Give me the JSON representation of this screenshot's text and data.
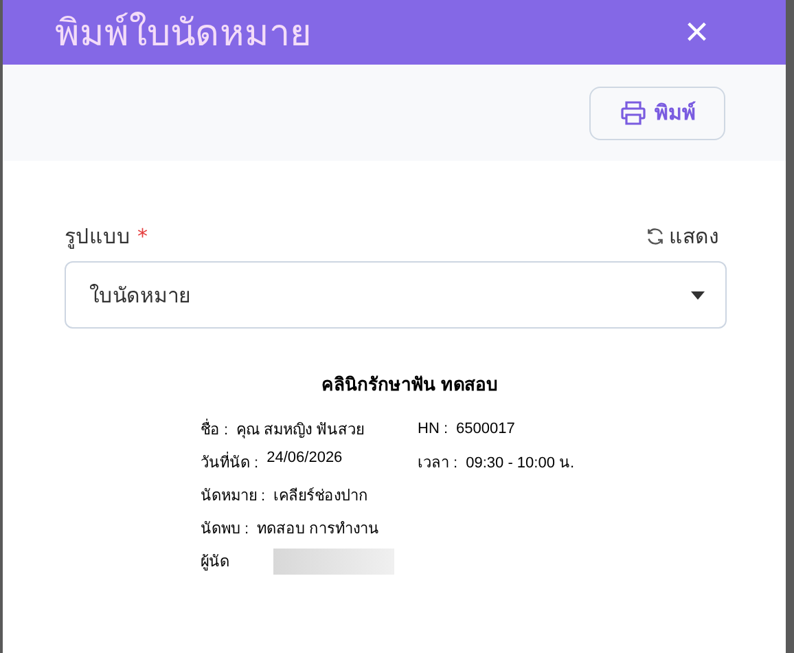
{
  "dialog": {
    "title": "พิมพ์ใบนัดหมาย",
    "close": "×"
  },
  "toolbar": {
    "print_button": "พิมพ์"
  },
  "form": {
    "label": "รูปแบบ",
    "required_mark": "*",
    "refresh_link": "แสดง",
    "select_value": "ใบนัดหมาย"
  },
  "preview": {
    "title": "คลินิกรักษาฟัน ทดสอบ",
    "lines": [
      {
        "fields": [
          {
            "label": "ชื่อ :",
            "value": "คุณ สมหญิง ฟันสวย"
          },
          {
            "label": "HN :",
            "value": "6500017"
          }
        ]
      },
      {
        "fields": [
          {
            "label": "วันที่นัด :",
            "value": "24/06/2026"
          },
          {
            "label": "เวลา :",
            "value": "09:30  -  10:00  น."
          }
        ]
      },
      {
        "fields": [
          {
            "label": "นัดหมาย :",
            "value": "เคลียร์ช่องปาก"
          }
        ]
      },
      {
        "fields": [
          {
            "label": "นัดพบ :",
            "value": "ทดสอบ การทำงาน"
          }
        ]
      }
    ],
    "signature": {
      "label": "ผู้นัด"
    }
  }
}
